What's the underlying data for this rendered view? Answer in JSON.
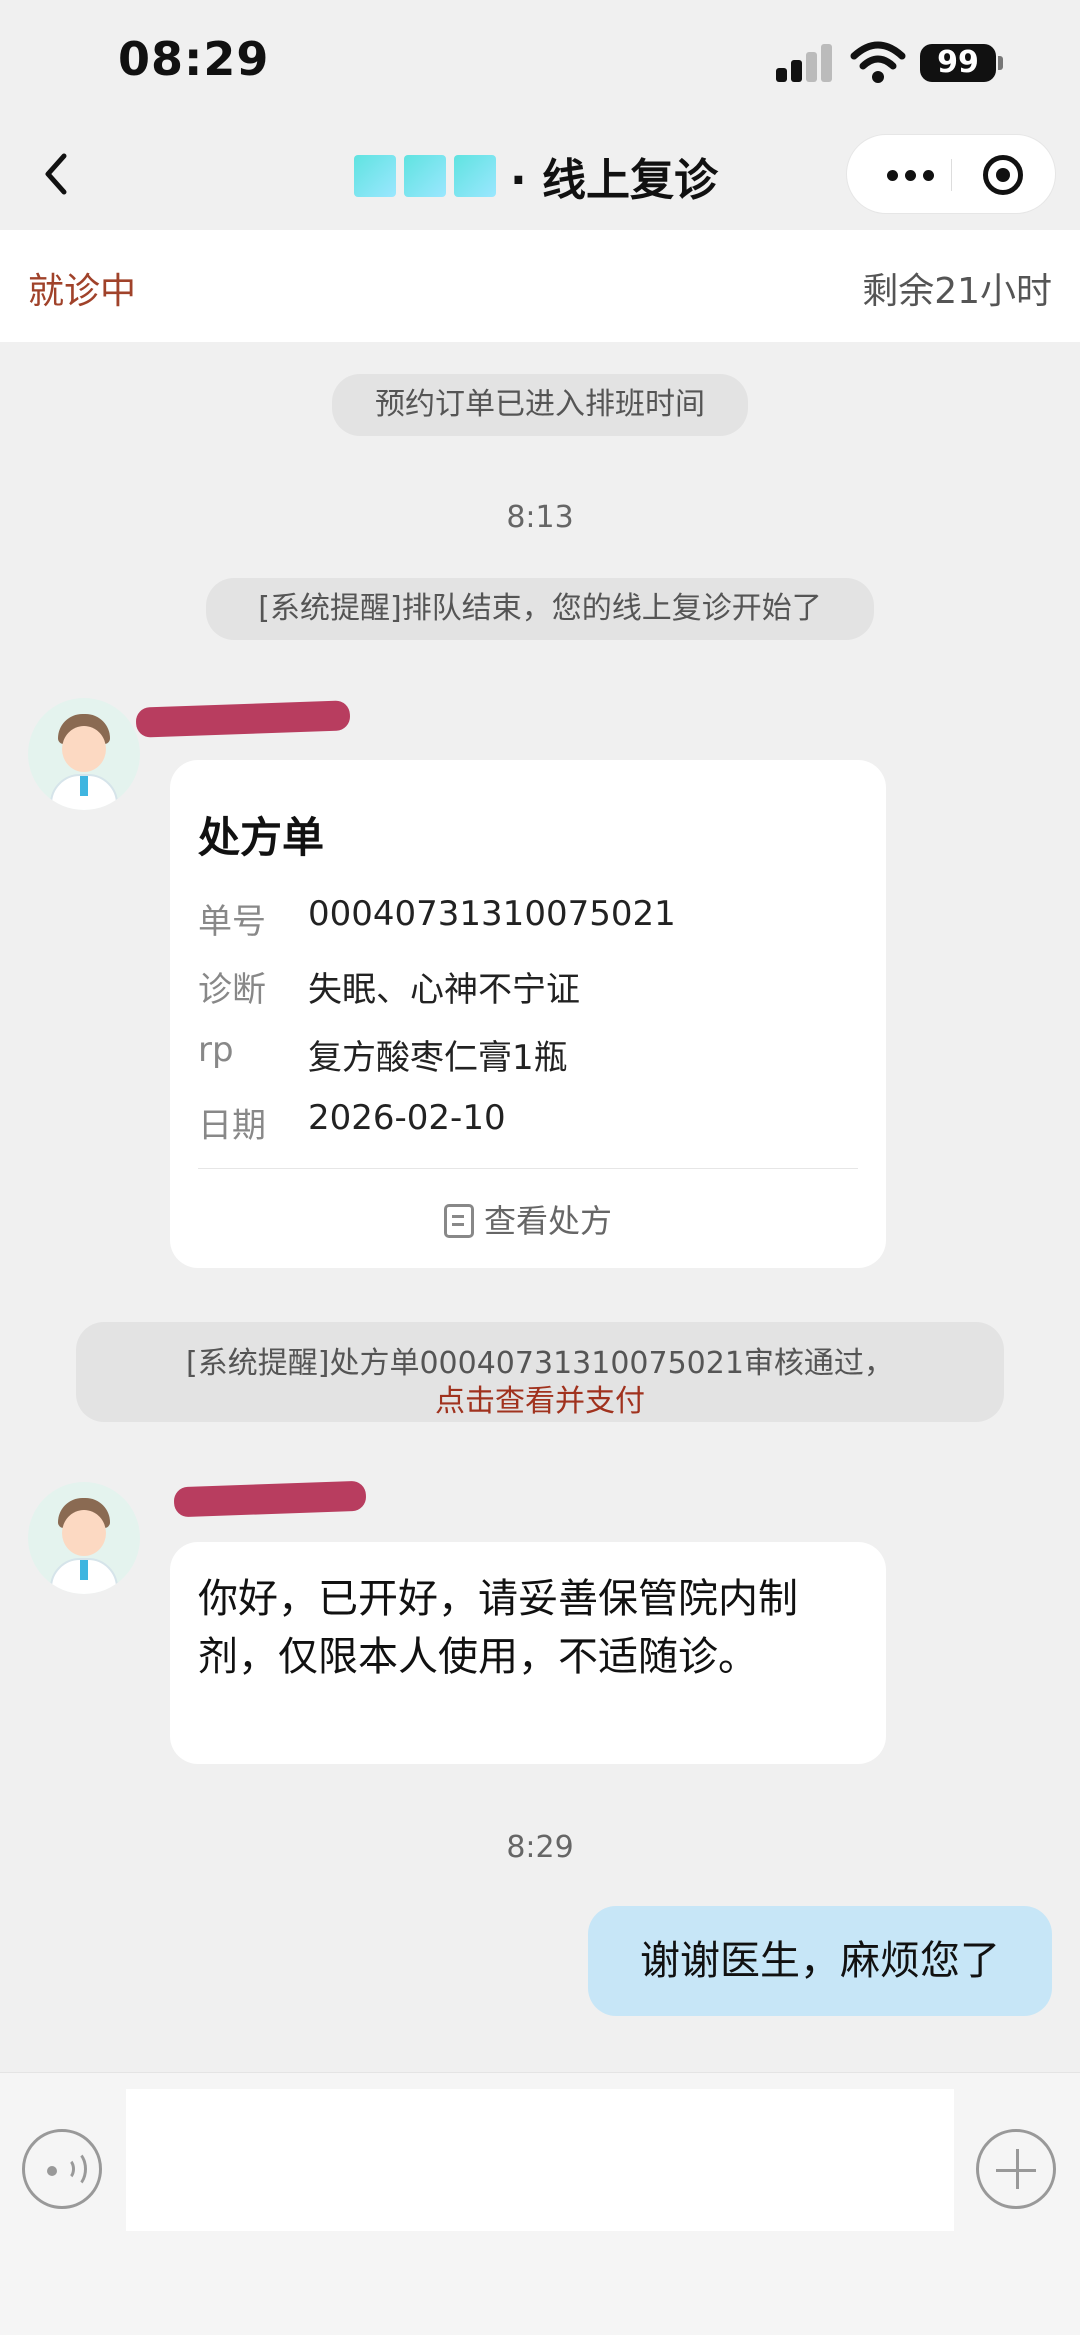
{
  "status_bar": {
    "time": "08:29",
    "battery": "99"
  },
  "nav": {
    "title": "· 线上复诊",
    "icons": [
      "back-icon",
      "more-icon",
      "close-circle-icon"
    ]
  },
  "session": {
    "status": "就诊中",
    "remaining": "剩余21小时"
  },
  "chat": {
    "system_1": "预约订单已进入排班时间",
    "time_1": "8:13",
    "system_2": "[系统提醒]排队结束，您的线上复诊开始了",
    "prescription": {
      "title": "处方单",
      "rows": [
        {
          "label": "单号",
          "value": "00040731310075021"
        },
        {
          "label": "诊断",
          "value": "失眠、心神不宁证"
        },
        {
          "label": "rp",
          "value": "复方酸枣仁膏1瓶"
        },
        {
          "label": "日期",
          "value": "2026-02-10"
        }
      ],
      "view_link": "查看处方"
    },
    "audit_notice": {
      "line1": "[系统提醒]处方单00040731310075021审核通过，",
      "line2": "点击查看并支付"
    },
    "doctor_message": "你好，已开好，请妥善保管院内制剂，仅限本人使用，不适随诊。",
    "time_2": "8:29",
    "my_message": "谢谢医生，麻烦您了"
  },
  "input": {
    "value": "",
    "placeholder": ""
  },
  "colors": {
    "status_red": "#a0422a",
    "my_bubble": "#c7e6f7",
    "background": "#f0f0f0"
  }
}
